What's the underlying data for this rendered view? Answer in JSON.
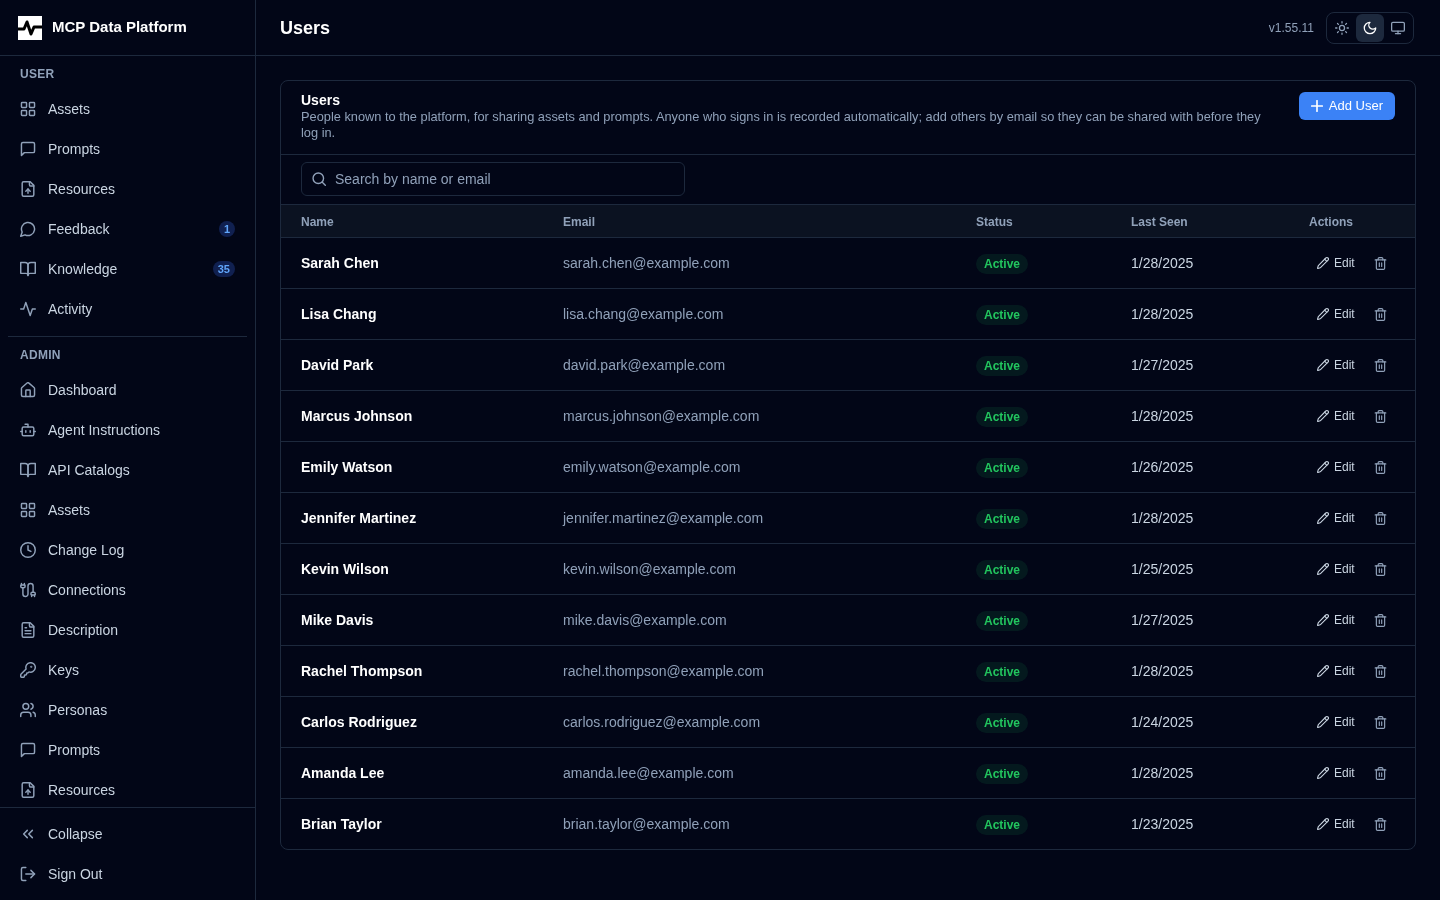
{
  "sidebar": {
    "brand": "MCP Data Platform",
    "sections": [
      {
        "heading": "USER",
        "items": [
          {
            "label": "Assets",
            "selected": false
          },
          {
            "label": "Prompts",
            "selected": false
          },
          {
            "label": "Resources",
            "selected": false
          },
          {
            "label": "Feedback",
            "badge": "1",
            "selected": false
          },
          {
            "label": "Knowledge",
            "badge": "35",
            "selected": false
          },
          {
            "label": "Activity",
            "selected": false
          }
        ]
      },
      {
        "heading": "ADMIN",
        "items": [
          {
            "label": "Dashboard",
            "selected": false
          },
          {
            "label": "Agent Instructions",
            "selected": false
          },
          {
            "label": "API Catalogs",
            "selected": false
          },
          {
            "label": "Assets",
            "selected": false
          },
          {
            "label": "Change Log",
            "selected": false
          },
          {
            "label": "Connections",
            "selected": false
          },
          {
            "label": "Description",
            "selected": false
          },
          {
            "label": "Keys",
            "selected": false
          },
          {
            "label": "Personas",
            "selected": false
          },
          {
            "label": "Prompts",
            "selected": false
          },
          {
            "label": "Resources",
            "selected": false
          }
        ]
      }
    ],
    "footer": [
      {
        "label": "Collapse"
      },
      {
        "label": "Sign Out"
      }
    ]
  },
  "header": {
    "title": "Users",
    "version": "v1.55.11",
    "theme_options": [
      {
        "kind": "light",
        "selected": false
      },
      {
        "kind": "dark",
        "selected": true
      },
      {
        "kind": "system",
        "selected": false
      }
    ]
  },
  "users_card": {
    "title": "Users",
    "description": "People known to the platform, for sharing assets and prompts. Anyone who signs in is recorded automatically; add others by email so they can be shared with before they log in.",
    "add_button": "Add User",
    "search": {
      "placeholder": "Search by name or email"
    },
    "table": {
      "columns": [
        "Name",
        "Email",
        "Status",
        "Last Seen",
        "Actions"
      ],
      "rows": [
        {
          "name": "Sarah Chen",
          "email": "sarah.chen@example.com",
          "status": "Active",
          "last_seen": "1/28/2025",
          "edit": "Edit"
        },
        {
          "name": "Lisa Chang",
          "email": "lisa.chang@example.com",
          "status": "Active",
          "last_seen": "1/28/2025",
          "edit": "Edit"
        },
        {
          "name": "David Park",
          "email": "david.park@example.com",
          "status": "Active",
          "last_seen": "1/27/2025",
          "edit": "Edit"
        },
        {
          "name": "Marcus Johnson",
          "email": "marcus.johnson@example.com",
          "status": "Active",
          "last_seen": "1/28/2025",
          "edit": "Edit"
        },
        {
          "name": "Emily Watson",
          "email": "emily.watson@example.com",
          "status": "Active",
          "last_seen": "1/26/2025",
          "edit": "Edit"
        },
        {
          "name": "Jennifer Martinez",
          "email": "jennifer.martinez@example.com",
          "status": "Active",
          "last_seen": "1/28/2025",
          "edit": "Edit"
        },
        {
          "name": "Kevin Wilson",
          "email": "kevin.wilson@example.com",
          "status": "Active",
          "last_seen": "1/25/2025",
          "edit": "Edit"
        },
        {
          "name": "Mike Davis",
          "email": "mike.davis@example.com",
          "status": "Active",
          "last_seen": "1/27/2025",
          "edit": "Edit"
        },
        {
          "name": "Rachel Thompson",
          "email": "rachel.thompson@example.com",
          "status": "Active",
          "last_seen": "1/28/2025",
          "edit": "Edit"
        },
        {
          "name": "Carlos Rodriguez",
          "email": "carlos.rodriguez@example.com",
          "status": "Active",
          "last_seen": "1/24/2025",
          "edit": "Edit"
        },
        {
          "name": "Amanda Lee",
          "email": "amanda.lee@example.com",
          "status": "Active",
          "last_seen": "1/28/2025",
          "edit": "Edit"
        },
        {
          "name": "Brian Taylor",
          "email": "brian.taylor@example.com",
          "status": "Active",
          "last_seen": "1/23/2025",
          "edit": "Edit"
        }
      ]
    }
  }
}
